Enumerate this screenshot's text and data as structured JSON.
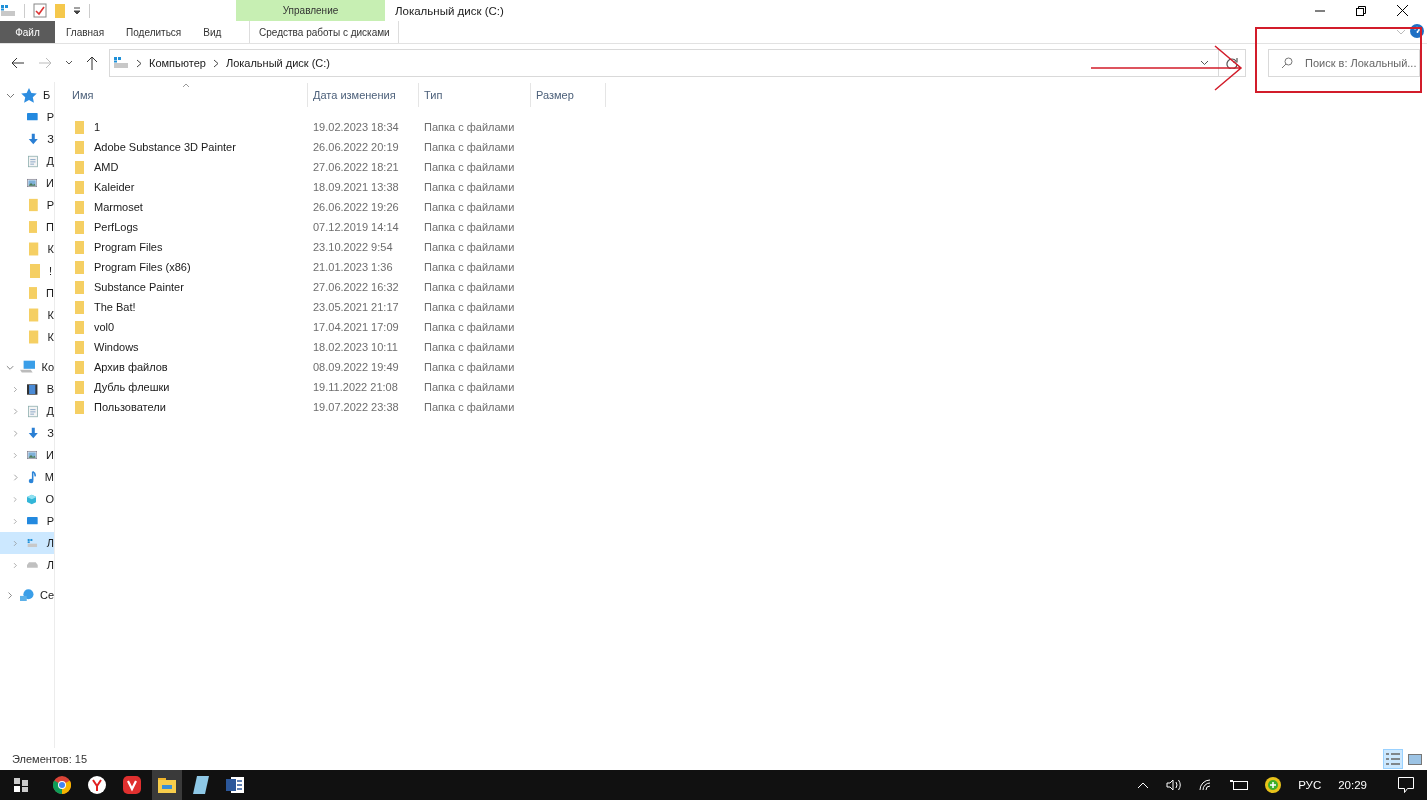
{
  "window": {
    "title": "Локальный диск (C:)"
  },
  "ribbon": {
    "context_group": "Управление",
    "tabs": [
      {
        "label": "Файл",
        "kind": "file",
        "selected": false
      },
      {
        "label": "Главная",
        "kind": "plain",
        "selected": false
      },
      {
        "label": "Поделиться",
        "kind": "plain",
        "selected": false
      },
      {
        "label": "Вид",
        "kind": "plain",
        "selected": false
      },
      {
        "label": "Средства работы с дисками",
        "kind": "context",
        "selected": false
      }
    ]
  },
  "address_bar": {
    "path": [
      "Компьютер",
      "Локальный диск (C:)"
    ]
  },
  "search": {
    "placeholder": "Поиск в: Локальный..."
  },
  "navigation": [
    {
      "label": "Б",
      "kind": "star",
      "expanded": true,
      "selected": false,
      "children": [
        {
          "label": "Р",
          "kind": "desktop",
          "selected": false
        },
        {
          "label": "З",
          "kind": "download",
          "selected": false
        },
        {
          "label": "Д",
          "kind": "document",
          "selected": false
        },
        {
          "label": "И",
          "kind": "image",
          "selected": false
        },
        {
          "label": "Р",
          "kind": "folder",
          "selected": false
        },
        {
          "label": "П",
          "kind": "folder",
          "selected": false
        },
        {
          "label": "К",
          "kind": "folder",
          "selected": false
        },
        {
          "label": "!",
          "kind": "folder",
          "selected": false
        },
        {
          "label": "П",
          "kind": "folder",
          "selected": false
        },
        {
          "label": "К",
          "kind": "folder",
          "selected": false
        },
        {
          "label": "К",
          "kind": "folder",
          "selected": false
        }
      ]
    },
    {
      "label": "Ко",
      "kind": "computer",
      "expanded": true,
      "selected": false,
      "children": [
        {
          "label": "В",
          "kind": "video",
          "expanded": false,
          "selected": false
        },
        {
          "label": "Д",
          "kind": "document",
          "expanded": false,
          "selected": false
        },
        {
          "label": "З",
          "kind": "download",
          "expanded": false,
          "selected": false
        },
        {
          "label": "И",
          "kind": "image",
          "expanded": false,
          "selected": false
        },
        {
          "label": "М",
          "kind": "music",
          "expanded": false,
          "selected": false
        },
        {
          "label": "О",
          "kind": "cube",
          "expanded": false,
          "selected": false
        },
        {
          "label": "Р",
          "kind": "desktop",
          "expanded": false,
          "selected": false
        },
        {
          "label": "Л",
          "kind": "windrive",
          "expanded": false,
          "selected": true
        },
        {
          "label": "Л",
          "kind": "drive",
          "expanded": false,
          "selected": false
        }
      ]
    },
    {
      "label": "Се",
      "kind": "network",
      "expanded": false,
      "selected": false
    }
  ],
  "table": {
    "columns": [
      "Имя",
      "Дата изменения",
      "Тип",
      "Размер"
    ],
    "rows": [
      {
        "name": "1",
        "date": "19.02.2023 18:34",
        "type": "Папка с файлами"
      },
      {
        "name": "Adobe Substance 3D Painter",
        "date": "26.06.2022 20:19",
        "type": "Папка с файлами"
      },
      {
        "name": "AMD",
        "date": "27.06.2022 18:21",
        "type": "Папка с файлами"
      },
      {
        "name": "Kaleider",
        "date": "18.09.2021 13:38",
        "type": "Папка с файлами"
      },
      {
        "name": "Marmoset",
        "date": "26.06.2022 19:26",
        "type": "Папка с файлами"
      },
      {
        "name": "PerfLogs",
        "date": "07.12.2019 14:14",
        "type": "Папка с файлами"
      },
      {
        "name": "Program Files",
        "date": "23.10.2022 9:54",
        "type": "Папка с файлами"
      },
      {
        "name": "Program Files (x86)",
        "date": "21.01.2023 1:36",
        "type": "Папка с файлами"
      },
      {
        "name": "Substance Painter",
        "date": "27.06.2022 16:32",
        "type": "Папка с файлами"
      },
      {
        "name": "The Bat!",
        "date": "23.05.2021 21:17",
        "type": "Папка с файлами"
      },
      {
        "name": "vol0",
        "date": "17.04.2021 17:09",
        "type": "Папка с файлами"
      },
      {
        "name": "Windows",
        "date": "18.02.2023 10:11",
        "type": "Папка с файлами"
      },
      {
        "name": "Архив файлов",
        "date": "08.09.2022 19:49",
        "type": "Папка с файлами"
      },
      {
        "name": "Дубль флешки",
        "date": "19.11.2022 21:08",
        "type": "Папка с файлами"
      },
      {
        "name": "Пользователи",
        "date": "19.07.2022 23:38",
        "type": "Папка с файлами"
      }
    ]
  },
  "status_bar": {
    "count": "Элементов: 15"
  },
  "taskbar": {
    "language": "РУС",
    "time": "20:29"
  }
}
